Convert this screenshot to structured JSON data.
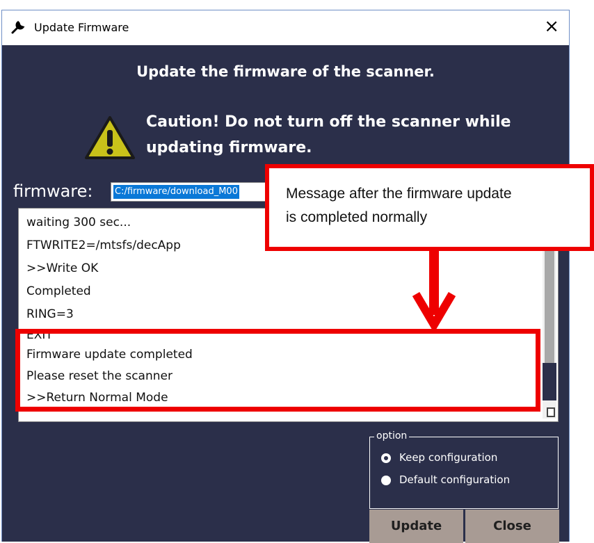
{
  "window": {
    "title": "Update Firmware",
    "close_glyph": "×",
    "heading": "Update the firmware of the scanner.",
    "caution_line1": "Caution! Do not turn off the scanner while",
    "caution_line2": "updating firmware."
  },
  "firmware": {
    "label": "firmware:",
    "path": "C:/firmware/download_M00"
  },
  "log": {
    "lines": [
      "waiting 300 sec...",
      "FTWRITE2=/mtsfs/decApp",
      ">>Write OK",
      "Completed",
      "RING=3",
      "EXIT",
      "Firmware update completed",
      "Please reset the scanner",
      ">>Return Normal Mode"
    ]
  },
  "option": {
    "legend": "option",
    "items": [
      {
        "label": "Keep configuration",
        "selected": true
      },
      {
        "label": "Default configuration",
        "selected": false
      }
    ]
  },
  "buttons": {
    "update": "Update",
    "close": "Close"
  },
  "callout": {
    "line1": "Message after the firmware update",
    "line2": "is completed normally"
  },
  "colors": {
    "dialog_bg": "#2b2f4a",
    "highlight": "#ee0000",
    "button_bg": "#a89b94",
    "selection": "#0a78d7"
  },
  "icons": {
    "title": "wrench-icon",
    "warning": "warning-triangle-icon",
    "close": "close-icon"
  }
}
